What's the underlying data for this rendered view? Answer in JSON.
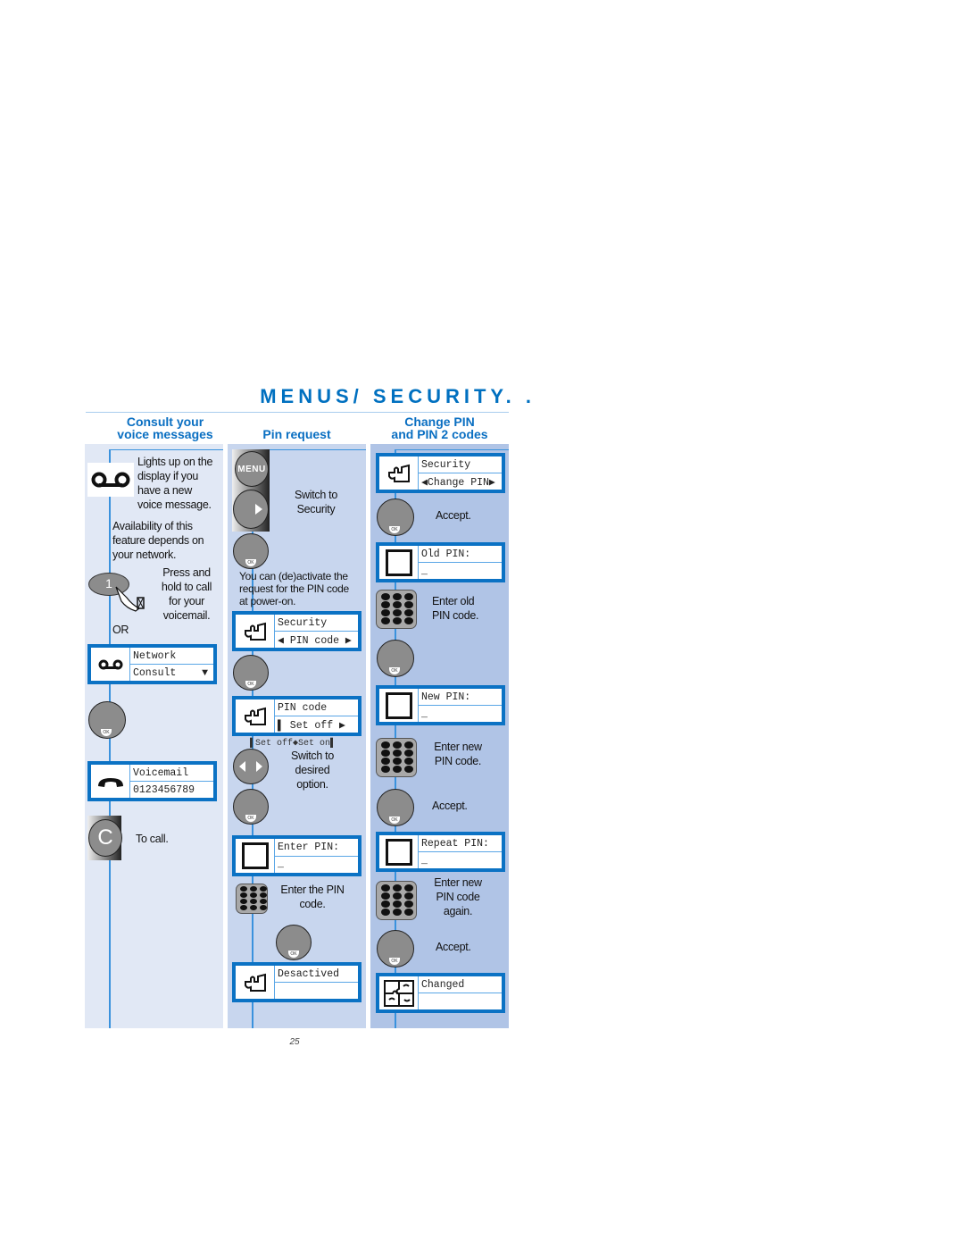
{
  "page": {
    "title": "MENUS/ SECURITY. .",
    "page_number": "25"
  },
  "columns": {
    "voice": {
      "heading_line1": "Consult your",
      "heading_line2": "voice messages",
      "intro": [
        "Lights up on the",
        "display if you",
        "have a new",
        "voice message."
      ],
      "availability": [
        "Availability of this",
        "feature depends on",
        "your network."
      ],
      "press_hold": [
        "Press and",
        "hold to call",
        "for your",
        "voicemail."
      ],
      "key_label": "1",
      "or_label": "OR",
      "screen1": {
        "line1": "Network",
        "line2": "Consult",
        "line2_symbol": "▼"
      },
      "ok_label": "OK",
      "screen2": {
        "line1": "Voicemail",
        "line2": "0123456789"
      },
      "c_key_label": "C",
      "to_call": "To call."
    },
    "pin_request": {
      "heading": "Pin request",
      "menu_label": "MENU",
      "switch_to": [
        "Switch to",
        "Security"
      ],
      "ok_label": "OK",
      "info": [
        "You can (de)activate the",
        "request for the PIN code",
        "at power-on."
      ],
      "screen1": {
        "line1": "Security",
        "line2": "◀ PIN code ▶"
      },
      "screen2": {
        "line1": "PIN code",
        "line2": "▌ Set off ▶"
      },
      "options_caption": "▌Set off◆Set on▌",
      "switch_desired": [
        "Switch to",
        "desired",
        "option."
      ],
      "screen3": {
        "line1": "Enter PIN:",
        "line2": "_"
      },
      "enter_pin": [
        "Enter the PIN",
        "code."
      ],
      "screen4": {
        "line1": "Desactived",
        "line2": ""
      }
    },
    "change_pin": {
      "heading_line1": "Change PIN",
      "heading_line2": "and PIN 2 codes",
      "ok_label": "OK",
      "screen1": {
        "line1": "Security",
        "line2": "◀Change PIN▶"
      },
      "accept1": "Accept.",
      "screen2": {
        "line1": "Old PIN:",
        "line2": "_"
      },
      "enter_old": [
        "Enter old",
        "PIN code."
      ],
      "screen3": {
        "line1": "New PIN:",
        "line2": "_"
      },
      "enter_new": [
        "Enter new",
        "PIN code."
      ],
      "accept2": "Accept.",
      "screen4": {
        "line1": "Repeat PIN:",
        "line2": "_"
      },
      "enter_again": [
        "Enter new",
        "PIN code",
        "again."
      ],
      "accept3": "Accept.",
      "screen5": {
        "line1": "Changed",
        "line2": ""
      }
    }
  },
  "colors": {
    "accent": "#0070c0",
    "panel1": "#e1e8f5",
    "panel2": "#c8d6ee",
    "panel3": "#b0c4e6"
  }
}
